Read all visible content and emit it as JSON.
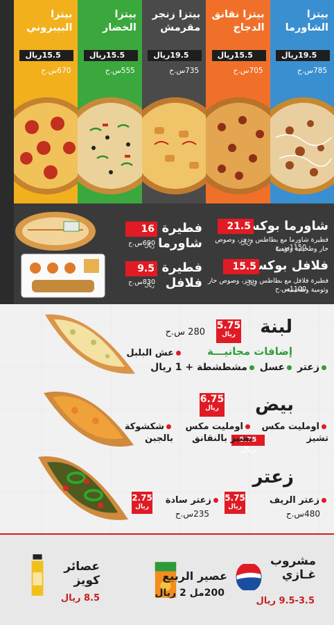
{
  "pizzas": [
    {
      "name_1": "بيتزا",
      "name_2": "الشاورما",
      "price": "19.5ريال",
      "calories": "785س.ح",
      "color": "#3a8fd1"
    },
    {
      "name_1": "بيتزا نقانق",
      "name_2": "الدجاج",
      "price": "15.5ريال",
      "calories": "705س.ح",
      "color": "#f0702a"
    },
    {
      "name_1": "بيتزا زنجر",
      "name_2": "مقرمش",
      "price": "19.5ريال",
      "calories": "735س.ح",
      "color": "#4a4a4a"
    },
    {
      "name_1": "بيتزا",
      "name_2": "الخضار",
      "price": "15.5ريال",
      "calories": "555س.ح",
      "color": "#3aa83c"
    },
    {
      "name_1": "بيتزا",
      "name_2": "البيبروني",
      "price": "15.5ريال",
      "calories": "670س.ح",
      "color": "#f2b01c"
    }
  ],
  "combos": {
    "shawarma_box": {
      "title": "شاورما بوكس",
      "price": "21.5",
      "unit": "ريال",
      "desc": "فطيرة شاورما مع بطاطس ودجز، وصوص حار وطحينية وثومية",
      "calories": "1150س.ح"
    },
    "falafel_box": {
      "title": "فلافل بوكس",
      "price": "15.5",
      "unit": "ريال",
      "desc": "فطيرة فلافل مع بطاطس ودجز، وصوص حار وثومية وطحينية.",
      "calories": "1100س.ح"
    },
    "fatira_shawarma": {
      "title_1": "فطيرة",
      "title_2": "شاورما",
      "price": "16",
      "unit": "ريال",
      "calories": "690س.ح"
    },
    "fatira_falafel": {
      "title_1": "فطيرة",
      "title_2": "فلافل",
      "price": "9.5",
      "unit": "ريال",
      "calories": "830س.ح"
    }
  },
  "fatayer": {
    "labneh": {
      "title": "لبنة",
      "price": "5.75",
      "unit": "ريال",
      "calories": "280 س.ح",
      "free_label": "إضافات مجانيـــة",
      "item_1": "زعتر",
      "item_2": "عسل",
      "item_3": "مشطشطة + 1 ريال",
      "item_4": "عش البلبل"
    },
    "eggs": {
      "title": "بيض",
      "price": "6.75",
      "unit": "ريال",
      "item_1": "اومليت مكس",
      "item_1b": "تشيز",
      "item_1_price": "5.75",
      "item_2": "اومليت مكس",
      "item_2b": "تشيز بالنقانق",
      "item_3": "شكشوكة",
      "item_3b": "بالجبن"
    },
    "zaatar": {
      "title": "زعتر",
      "rif_name": "زعتر الريف",
      "rif_price": "5.75",
      "rif_unit": "ريال",
      "rif_calories": "480س.ح",
      "plain_name": "زعتر سادة",
      "plain_price": "2.75",
      "plain_unit": "ريال",
      "plain_calories": "235س.ح"
    }
  },
  "drinks": {
    "soda": {
      "title_1": "مشروب",
      "title_2": "غـازي",
      "price": "9.5-3.5 ريال"
    },
    "rabea": {
      "title": "عصير الربيع",
      "sub": "200مل 2 ريال"
    },
    "juice": {
      "title_1": "عصائر",
      "title_2": "كويز",
      "price": "8.5 ريال"
    }
  },
  "accent_red": "#e01b24",
  "accent_green": "#2e9d3a"
}
